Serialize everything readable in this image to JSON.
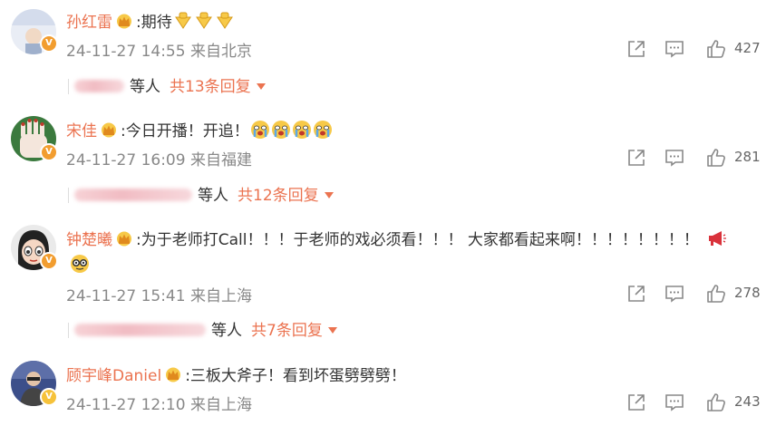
{
  "comments": [
    {
      "name": "孙红雷",
      "text": ":期待",
      "time": "24-11-27 14:55",
      "location": "来自北京",
      "likes": "427",
      "reply": {
        "etc": "等人",
        "total": "共13条回复"
      }
    },
    {
      "name": "宋佳",
      "text": ":今日开播！开追！",
      "time": "24-11-27 16:09",
      "location": "来自福建",
      "likes": "281",
      "reply": {
        "etc": "等人",
        "total": "共12条回复"
      }
    },
    {
      "name": "钟楚曦",
      "text": ":为于老师打Call！！！于老师的戏必须看！！！  大家都看起来啊！！！！！！！！",
      "time": "24-11-27 15:41",
      "location": "来自上海",
      "likes": "278",
      "reply": {
        "etc": "等人",
        "total": "共7条回复"
      }
    },
    {
      "name": "顾宇峰Daniel",
      "text": ":三板大斧子！看到坏蛋劈劈劈！",
      "time": "24-11-27 12:10",
      "location": "来自上海",
      "likes": "243"
    }
  ],
  "colors": {
    "name": "#eb7350",
    "meta": "#888888",
    "text": "#333333"
  }
}
